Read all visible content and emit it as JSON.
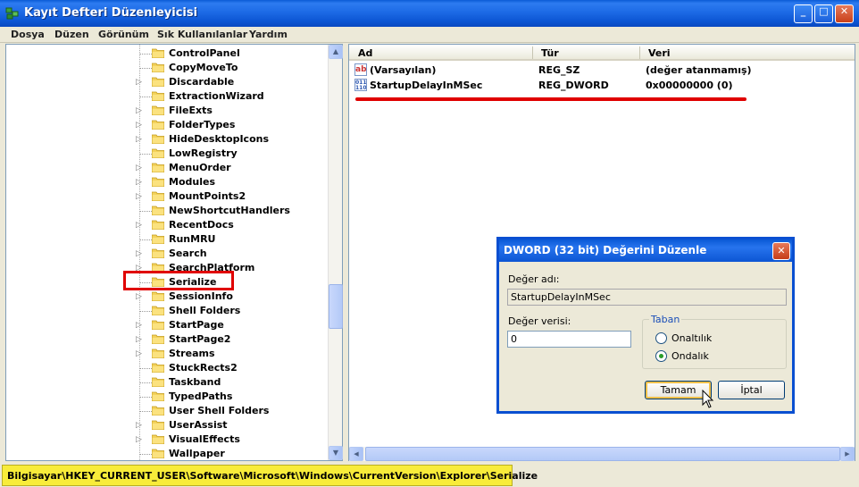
{
  "window": {
    "title": "Kayıt Defteri Düzenleyicisi",
    "minimize": "_",
    "maximize": "□",
    "close": "✕"
  },
  "menu": [
    "Dosya",
    "Düzen",
    "Görünüm",
    "Sık Kullanılanlar",
    "Yardım"
  ],
  "tree": {
    "items": [
      {
        "label": "ControlPanel",
        "expandable": false
      },
      {
        "label": "CopyMoveTo",
        "expandable": false
      },
      {
        "label": "Discardable",
        "expandable": true
      },
      {
        "label": "ExtractionWizard",
        "expandable": false
      },
      {
        "label": "FileExts",
        "expandable": true
      },
      {
        "label": "FolderTypes",
        "expandable": true
      },
      {
        "label": "HideDesktopIcons",
        "expandable": true
      },
      {
        "label": "LowRegistry",
        "expandable": false
      },
      {
        "label": "MenuOrder",
        "expandable": true
      },
      {
        "label": "Modules",
        "expandable": true
      },
      {
        "label": "MountPoints2",
        "expandable": true
      },
      {
        "label": "NewShortcutHandlers",
        "expandable": false
      },
      {
        "label": "RecentDocs",
        "expandable": true
      },
      {
        "label": "RunMRU",
        "expandable": false
      },
      {
        "label": "Search",
        "expandable": true
      },
      {
        "label": "SearchPlatform",
        "expandable": true
      },
      {
        "label": "Serialize",
        "expandable": false,
        "selected": true
      },
      {
        "label": "SessionInfo",
        "expandable": true
      },
      {
        "label": "Shell Folders",
        "expandable": false
      },
      {
        "label": "StartPage",
        "expandable": true
      },
      {
        "label": "StartPage2",
        "expandable": true
      },
      {
        "label": "Streams",
        "expandable": true
      },
      {
        "label": "StuckRects2",
        "expandable": false
      },
      {
        "label": "Taskband",
        "expandable": false
      },
      {
        "label": "TypedPaths",
        "expandable": false
      },
      {
        "label": "User Shell Folders",
        "expandable": false
      },
      {
        "label": "UserAssist",
        "expandable": true
      },
      {
        "label": "VisualEffects",
        "expandable": true
      },
      {
        "label": "Wallpaper",
        "expandable": false
      }
    ]
  },
  "list": {
    "columns": [
      "Ad",
      "Tür",
      "Veri"
    ],
    "rows": [
      {
        "name": "(Varsayılan)",
        "type": "REG_SZ",
        "data": "(değer atanmamış)",
        "icon": "string-value-icon"
      },
      {
        "name": "StartupDelayInMSec",
        "type": "REG_DWORD",
        "data": "0x00000000 (0)",
        "icon": "binary-value-icon"
      }
    ]
  },
  "status": {
    "path": "Bilgisayar\\HKEY_CURRENT_USER\\Software\\Microsoft\\Windows\\CurrentVersion\\Explorer\\Serialize"
  },
  "dialog": {
    "title": "DWORD (32 bit) Değerini Düzenle",
    "close": "✕",
    "value_name_label": "Değer adı:",
    "value_name": "StartupDelayInMSec",
    "value_data_label": "Değer verisi:",
    "value_data": "0",
    "base_label": "Taban",
    "hex_label": "Onaltılık",
    "dec_label": "Ondalık",
    "selected_base": "Ondalık",
    "ok_label": "Tamam",
    "cancel_label": "İptal"
  },
  "colors": {
    "accent_highlight": "#e00000",
    "status_bar_highlight": "#f8ec3a",
    "title_bar": "#0a5ad6"
  }
}
